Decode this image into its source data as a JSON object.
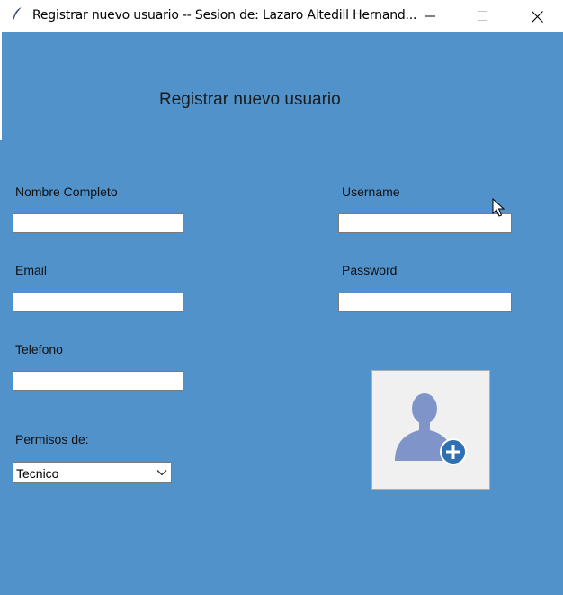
{
  "window": {
    "title": "Registrar nuevo usuario -- Sesion de: Lazaro Altedill Hernand...",
    "icon": "feather-icon"
  },
  "form": {
    "heading": "Registrar nuevo usuario",
    "fields": {
      "nombre_label": "Nombre Completo",
      "nombre_value": "",
      "username_label": "Username",
      "username_value": "",
      "email_label": "Email",
      "email_value": "",
      "password_label": "Password",
      "password_value": "",
      "telefono_label": "Telefono",
      "telefono_value": ""
    },
    "permisos": {
      "label": "Permisos de:",
      "selected": "Tecnico"
    },
    "add_button_icon": "user-add-icon"
  },
  "colors": {
    "background": "#5192cb",
    "titlebar": "#ffffff",
    "button_face": "#f0f0f0",
    "icon_person": "#7f95c9",
    "icon_plus": "#2f6fb3"
  }
}
